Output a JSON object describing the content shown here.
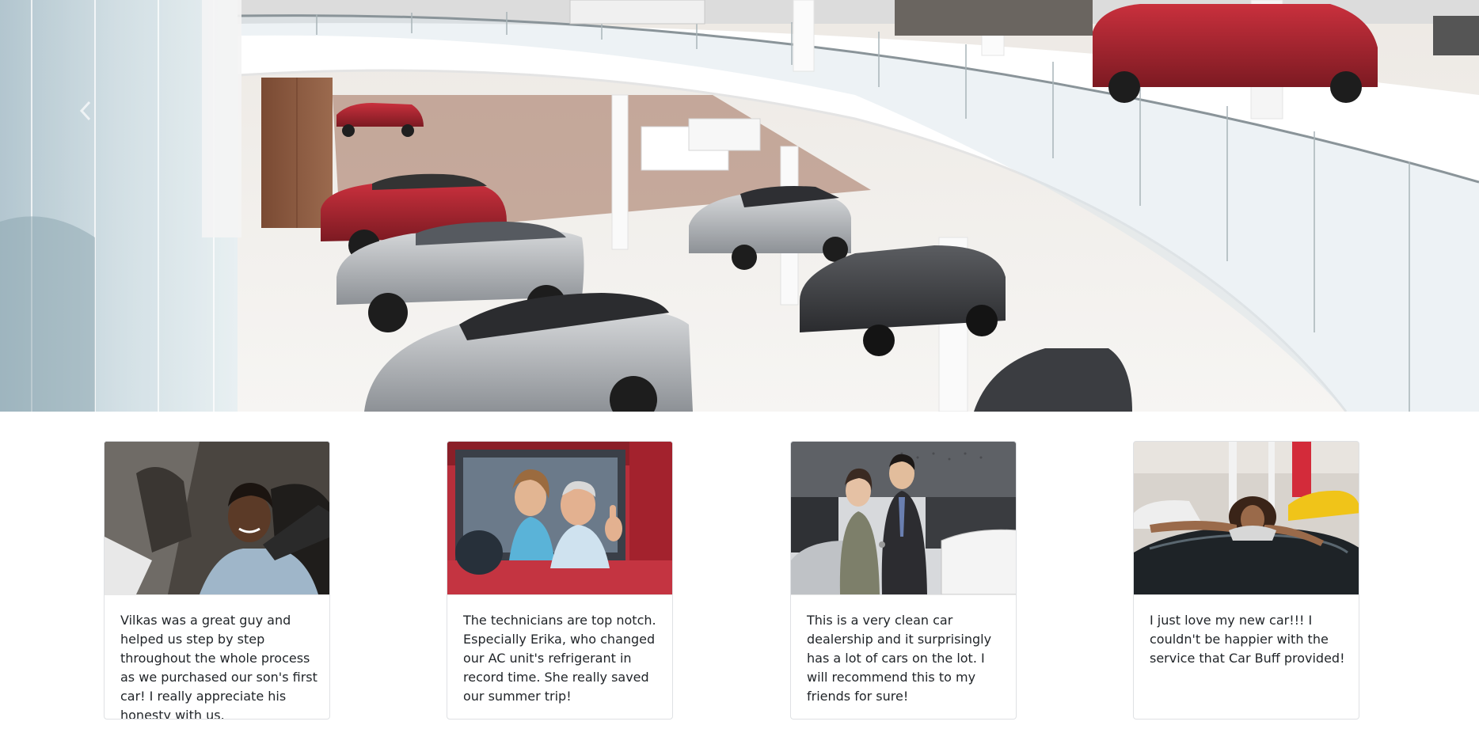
{
  "hero": {
    "prev_control": "chevron-left-icon",
    "next_control": "chevron-right-icon"
  },
  "testimonials": [
    {
      "photo": "customer-teen-in-car-photo",
      "text": "Vilkas was a great guy and helped us step by step throughout the whole process as we purchased our son's first car! I really appreciate his honesty with us."
    },
    {
      "photo": "couple-thumbs-up-in-red-car-photo",
      "text": "The technicians are top notch. Especially Erika, who changed our AC unit's refrigerant in record time. She really saved our summer trip!"
    },
    {
      "photo": "couple-receiving-car-keys-photo",
      "text": "This is a very clean car dealership and it surprisingly has a lot of cars on the lot. I will recommend this to my friends for sure!"
    },
    {
      "photo": "woman-hugging-new-car-photo",
      "text": "I just love my new car!!! I couldn't be happier with the service that Car Buff provided!"
    }
  ]
}
